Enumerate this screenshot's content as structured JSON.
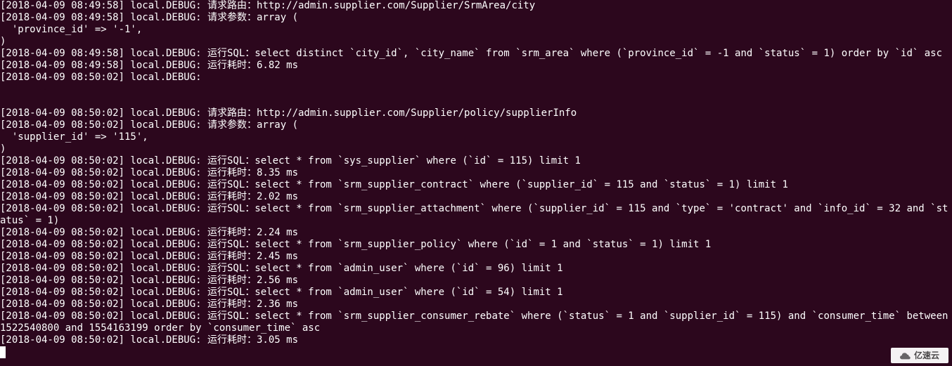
{
  "log": {
    "lines": [
      "[2018-04-09 08:49:58] local.DEBUG: 请求路由：http://admin.supplier.com/Supplier/SrmArea/city",
      "[2018-04-09 08:49:58] local.DEBUG: 请求参数：array (",
      "  'province_id' => '-1',",
      ")",
      "[2018-04-09 08:49:58] local.DEBUG: 运行SQL：select distinct `city_id`, `city_name` from `srm_area` where (`province_id` = -1 and `status` = 1) order by `id` asc",
      "[2018-04-09 08:49:58] local.DEBUG: 运行耗时：6.82 ms",
      "[2018-04-09 08:50:02] local.DEBUG:",
      "",
      "",
      "[2018-04-09 08:50:02] local.DEBUG: 请求路由：http://admin.supplier.com/Supplier/policy/supplierInfo",
      "[2018-04-09 08:50:02] local.DEBUG: 请求参数：array (",
      "  'supplier_id' => '115',",
      ")",
      "[2018-04-09 08:50:02] local.DEBUG: 运行SQL：select * from `sys_supplier` where (`id` = 115) limit 1",
      "[2018-04-09 08:50:02] local.DEBUG: 运行耗时：8.35 ms",
      "[2018-04-09 08:50:02] local.DEBUG: 运行SQL：select * from `srm_supplier_contract` where (`supplier_id` = 115 and `status` = 1) limit 1",
      "[2018-04-09 08:50:02] local.DEBUG: 运行耗时：2.02 ms",
      "[2018-04-09 08:50:02] local.DEBUG: 运行SQL：select * from `srm_supplier_attachment` where (`supplier_id` = 115 and `type` = 'contract' and `info_id` = 32 and `status` = 1)",
      "[2018-04-09 08:50:02] local.DEBUG: 运行耗时：2.24 ms",
      "[2018-04-09 08:50:02] local.DEBUG: 运行SQL：select * from `srm_supplier_policy` where (`id` = 1 and `status` = 1) limit 1",
      "[2018-04-09 08:50:02] local.DEBUG: 运行耗时：2.45 ms",
      "[2018-04-09 08:50:02] local.DEBUG: 运行SQL：select * from `admin_user` where (`id` = 96) limit 1",
      "[2018-04-09 08:50:02] local.DEBUG: 运行耗时：2.56 ms",
      "[2018-04-09 08:50:02] local.DEBUG: 运行SQL：select * from `admin_user` where (`id` = 54) limit 1",
      "[2018-04-09 08:50:02] local.DEBUG: 运行耗时：2.36 ms",
      "[2018-04-09 08:50:02] local.DEBUG: 运行SQL：select * from `srm_supplier_consumer_rebate` where (`status` = 1 and `supplier_id` = 115) and `consumer_time` between 1522540800 and 1554163199 order by `consumer_time` asc",
      "[2018-04-09 08:50:02] local.DEBUG: 运行耗时：3.05 ms"
    ]
  },
  "watermark": {
    "text": "亿速云"
  }
}
